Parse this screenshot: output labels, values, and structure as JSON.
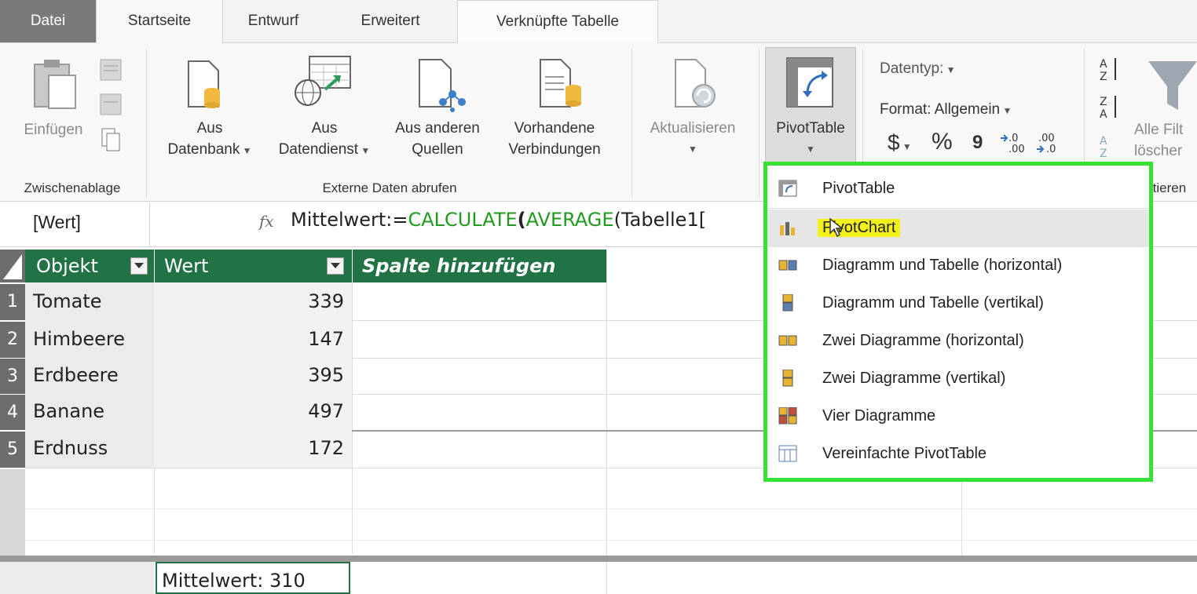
{
  "tabs": {
    "file": "Datei",
    "home": "Startseite",
    "design": "Entwurf",
    "advanced": "Erweitert",
    "linked_table": "Verknüpfte Tabelle"
  },
  "ribbon": {
    "paste": "Einfügen",
    "clipboard_group": "Zwischenablage",
    "from_database_1": "Aus",
    "from_database_2": "Datenbank",
    "from_service_1": "Aus",
    "from_service_2": "Datendienst",
    "from_other_1": "Aus anderen",
    "from_other_2": "Quellen",
    "existing_1": "Vorhandene",
    "existing_2": "Verbindungen",
    "external_group": "Externe Daten abrufen",
    "refresh": "Aktualisieren",
    "pivottable": "PivotTable",
    "datatype": "Datentyp:",
    "format": "Format: Allgemein",
    "currency_symbol": "$",
    "percent_symbol": "%",
    "comma_symbol": "9",
    "inc_decimal": ".00",
    "dec_decimal": ".00",
    "clear_filters_1": "Alle Filt",
    "clear_filters_2": "löscher",
    "sort_group_partial": "rtieren"
  },
  "formula_bar": {
    "name_box": "[Wert]",
    "fx": "fx",
    "formula_prefix": "Mittelwert:=",
    "formula_calc": "CALCULATE",
    "formula_paren1": "(",
    "formula_avg": "AVERAGE",
    "formula_rest": "(Tabelle1["
  },
  "table": {
    "columns": [
      "Objekt",
      "Wert",
      "Spalte hinzufügen"
    ],
    "rows": [
      {
        "num": "1",
        "objekt": "Tomate",
        "wert": "339"
      },
      {
        "num": "2",
        "objekt": "Himbeere",
        "wert": "147"
      },
      {
        "num": "3",
        "objekt": "Erdbeere",
        "wert": "395"
      },
      {
        "num": "4",
        "objekt": "Banane",
        "wert": "497"
      },
      {
        "num": "5",
        "objekt": "Erdnuss",
        "wert": "172"
      }
    ],
    "measure": "Mittelwert: 310"
  },
  "menu": {
    "items": [
      {
        "label": "PivotTable",
        "icon": "pivottable-icon"
      },
      {
        "label": "PivotChart",
        "icon": "pivotchart-icon",
        "highlighted": true
      },
      {
        "label": "Diagramm und Tabelle (horizontal)",
        "icon": "chart-table-horizontal-icon"
      },
      {
        "label": "Diagramm und Tabelle (vertikal)",
        "icon": "chart-table-vertical-icon"
      },
      {
        "label": "Zwei Diagramme (horizontal)",
        "icon": "two-charts-horizontal-icon"
      },
      {
        "label": "Zwei Diagramme (vertikal)",
        "icon": "two-charts-vertical-icon"
      },
      {
        "label": "Vier Diagramme",
        "icon": "four-charts-icon"
      },
      {
        "label": "Vereinfachte PivotTable",
        "icon": "flattened-pivottable-icon"
      }
    ]
  },
  "colors": {
    "table_header": "#217346",
    "highlight_border": "#33e233",
    "highlight_text_bg": "#f2f21a",
    "formula_function": "#1f9a1f"
  }
}
